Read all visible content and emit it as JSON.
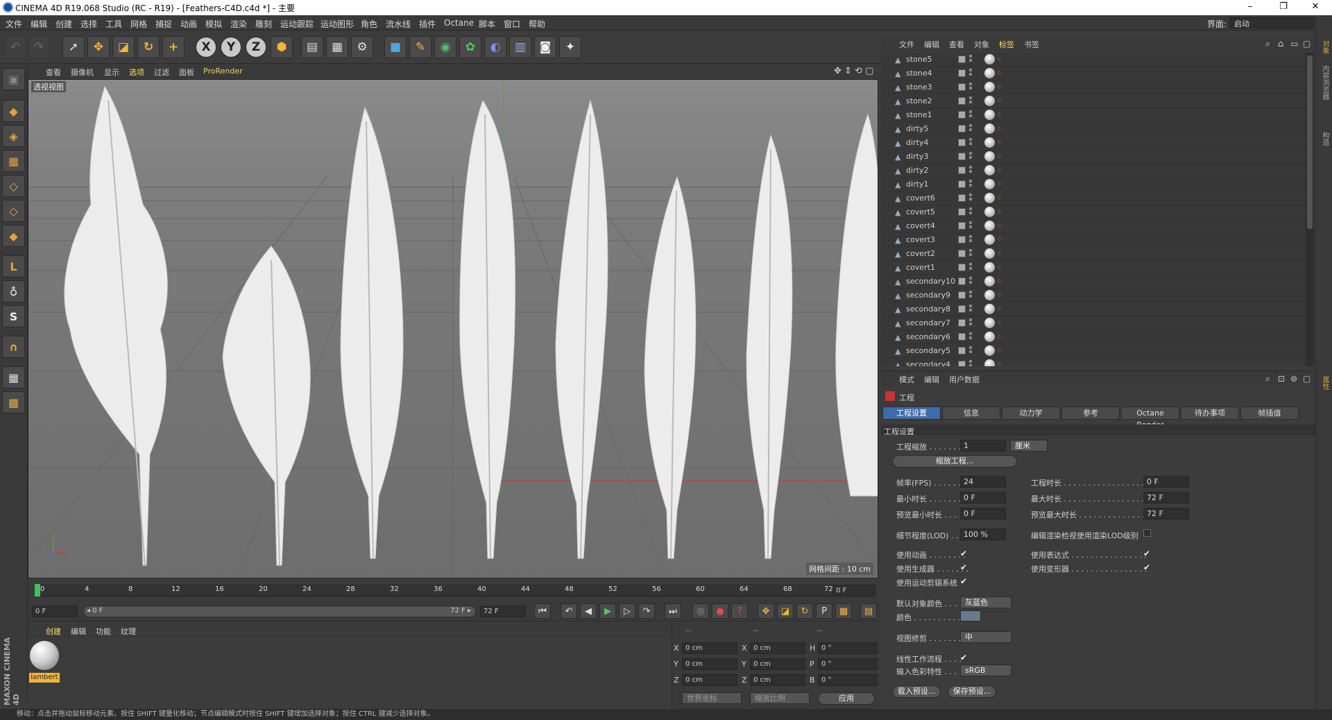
{
  "window": {
    "title": "CINEMA 4D R19.068 Studio (RC - R19) - [Feathers-C4D.c4d *] - 主要",
    "minimize": "–",
    "restore": "❐",
    "close": "✕"
  },
  "menubar": {
    "items": [
      "文件",
      "编辑",
      "创建",
      "选择",
      "工具",
      "网格",
      "捕捉",
      "动画",
      "模拟",
      "渲染",
      "雕刻",
      "运动跟踪",
      "运动图形",
      "角色",
      "流水线",
      "插件",
      "Octane",
      "脚本",
      "窗口",
      "帮助"
    ],
    "layout_label": "界面:",
    "layout_value": "启动"
  },
  "toolbar": {
    "axis_x": "X",
    "axis_y": "Y",
    "axis_z": "Z"
  },
  "viewport": {
    "menu": [
      "查看",
      "摄像机",
      "显示",
      "选项",
      "过滤",
      "面板",
      "ProRender"
    ],
    "label": "透视视图",
    "grid_note": "网格间距 : 10 cm",
    "colors": {
      "background": "#737373",
      "feather": "#ececec",
      "x_axis": "#c83a3a",
      "y_axis": "#3fae3f"
    }
  },
  "timeline": {
    "ticks": [
      "0",
      "4",
      "8",
      "12",
      "16",
      "20",
      "24",
      "28",
      "32",
      "36",
      "40",
      "44",
      "48",
      "52",
      "56",
      "60",
      "64",
      "68",
      "72"
    ],
    "current_frame_field": "0 F",
    "start_field": "0 F",
    "range_start": "◂ 0 F",
    "range_end": "72 F ▸",
    "end_field": "72 F"
  },
  "materials": {
    "menu": [
      "创建",
      "编辑",
      "功能",
      "纹理"
    ],
    "items": [
      {
        "name": "lambert"
      }
    ]
  },
  "coords": {
    "headers": [
      "--",
      "--",
      "--"
    ],
    "rows": [
      {
        "a": "X",
        "av": "0 cm",
        "b": "X",
        "bv": "0 cm",
        "c": "H",
        "cv": "0 °"
      },
      {
        "a": "Y",
        "av": "0 cm",
        "b": "Y",
        "bv": "0 cm",
        "c": "P",
        "cv": "0 °"
      },
      {
        "a": "Z",
        "av": "0 cm",
        "b": "Z",
        "bv": "0 cm",
        "c": "B",
        "cv": "0 °"
      }
    ],
    "world": "世界坐标",
    "scale": "缩放比例",
    "apply": "应用"
  },
  "status": "移动：点击并拖动鼠标移动元素。按住 SHIFT 键量化移动；节点编辑模式时按住 SHIFT 键增加选择对象；按住 CTRL 键减少选择对象。",
  "object_manager": {
    "menu": [
      "文件",
      "编辑",
      "查看",
      "对象",
      "标签",
      "书签"
    ],
    "objects": [
      "stone5",
      "stone4",
      "stone3",
      "stone2",
      "stone1",
      "dirty5",
      "dirty4",
      "dirty3",
      "dirty2",
      "dirty1",
      "covert6",
      "covert5",
      "covert4",
      "covert3",
      "covert2",
      "covert1",
      "secondary10",
      "secondary9",
      "secondary8",
      "secondary7",
      "secondary6",
      "secondary5",
      "secondary4"
    ]
  },
  "attributes": {
    "menu": [
      "模式",
      "编辑",
      "用户数据"
    ],
    "heading": "工程",
    "tabs": [
      "工程设置",
      "信息",
      "动力学",
      "参考",
      "Octane Render",
      "待办事项",
      "帧插值"
    ],
    "section": "工程设置",
    "scale_label": "工程缩放 . . . . . . .",
    "scale_value": "1",
    "scale_unit": "厘米",
    "scale_btn": "缩放工程...",
    "fps_label": "帧率(FPS) . . . . . . .",
    "fps_value": "24",
    "time_label": "工程时长 . . . . . . . . . . . . . . . . . .",
    "time_value": "0 F",
    "min_label": "最小时长 . . . . . . . .",
    "min_value": "0 F",
    "max_label": "最大时长 . . . . . . . . . . . . . . . . . .",
    "max_value": "72 F",
    "pmin_label": "预览最小时长 . . . .",
    "pmin_value": "0 F",
    "pmax_label": "预览最大时长 . . . . . . . . . . . . . . .",
    "pmax_value": "72 F",
    "lod_label": "细节程度(LOD) . . .",
    "lod_value": "100 %",
    "lod_render_label": "编辑渲染检视使用渲染LOD级别",
    "anim_label": "使用动画 . . . . . . . .",
    "expr_label": "使用表达式 . . . . . . . . . . . . . . . .",
    "gen_label": "使用生成器 . . . . . . .",
    "deform_label": "使用变形器 . . . . . . . . . . . . . . . .",
    "motion_label": "使用运动剪辑系统",
    "objcolor_label": "默认对象颜色 . . .",
    "objcolor_value": "灰蓝色",
    "color_label": "颜色 . . . . . . . . . . . .",
    "clip_label": "视图修剪 . . . . . . .",
    "clip_value": "中",
    "linear_label": "线性工作流程 . . . .",
    "profile_label": "输入色彩特性 . . . .",
    "profile_value": "sRGB",
    "load_btn": "载入预设...",
    "save_btn": "保存预设...",
    "check": "✔"
  },
  "side_tabs": [
    "对象",
    "内容浏览器",
    "构造",
    "属性"
  ],
  "maxon_logo": "MAXON CINEMA 4D"
}
